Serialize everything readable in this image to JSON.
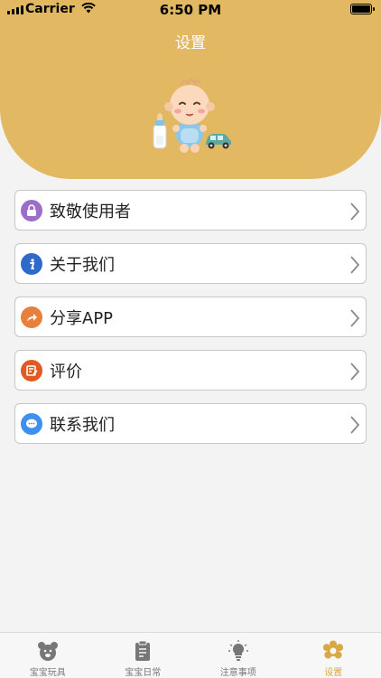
{
  "status_bar": {
    "carrier": "Carrier",
    "time": "6:50 PM"
  },
  "header": {
    "title": "设置"
  },
  "menu": [
    {
      "label": "致敬使用者",
      "icon": "lock-icon",
      "color": "#9b6fc8"
    },
    {
      "label": "关于我们",
      "icon": "info-icon",
      "color": "#2f69c9"
    },
    {
      "label": "分享APP",
      "icon": "share-icon",
      "color": "#e87f3a"
    },
    {
      "label": "评价",
      "icon": "rate-icon",
      "color": "#e05a24"
    },
    {
      "label": "联系我们",
      "icon": "chat-icon",
      "color": "#3d8ff0"
    }
  ],
  "tabs": [
    {
      "label": "宝宝玩具",
      "icon": "bear-icon",
      "active": false
    },
    {
      "label": "宝宝日常",
      "icon": "clipboard-icon",
      "active": false
    },
    {
      "label": "注意事项",
      "icon": "lightbulb-icon",
      "active": false
    },
    {
      "label": "设置",
      "icon": "gear-flower-icon",
      "active": true
    }
  ],
  "colors": {
    "header": "#e2b863",
    "accent": "#d9a844",
    "background": "#f3f3f3"
  }
}
